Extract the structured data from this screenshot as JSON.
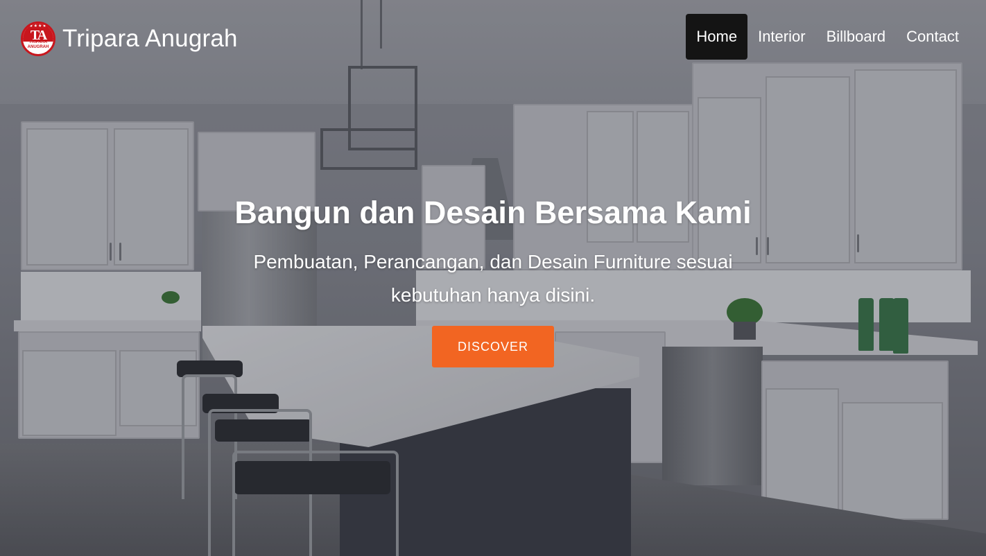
{
  "brand": {
    "logo_icon": "tripara-anugrah-logo",
    "logo_text": "TA",
    "logo_subtext": "TRIPARA ANUGRAH",
    "name": "Tripara Anugrah"
  },
  "nav": {
    "items": [
      {
        "label": "Home",
        "active": true
      },
      {
        "label": "Interior",
        "active": false
      },
      {
        "label": "Billboard",
        "active": false
      },
      {
        "label": "Contact",
        "active": false
      }
    ]
  },
  "hero": {
    "title": "Bangun dan Desain Bersama Kami",
    "subtitle": "Pembuatan, Perancangan, dan Desain Furniture sesuai kebutuhan hanya disini.",
    "cta_label": "DISCOVER",
    "background": "kitchen-interior-photo"
  },
  "colors": {
    "accent": "#f26522",
    "nav_active_bg": "#141414",
    "text": "#ffffff",
    "logo_red": "#c8161d"
  }
}
